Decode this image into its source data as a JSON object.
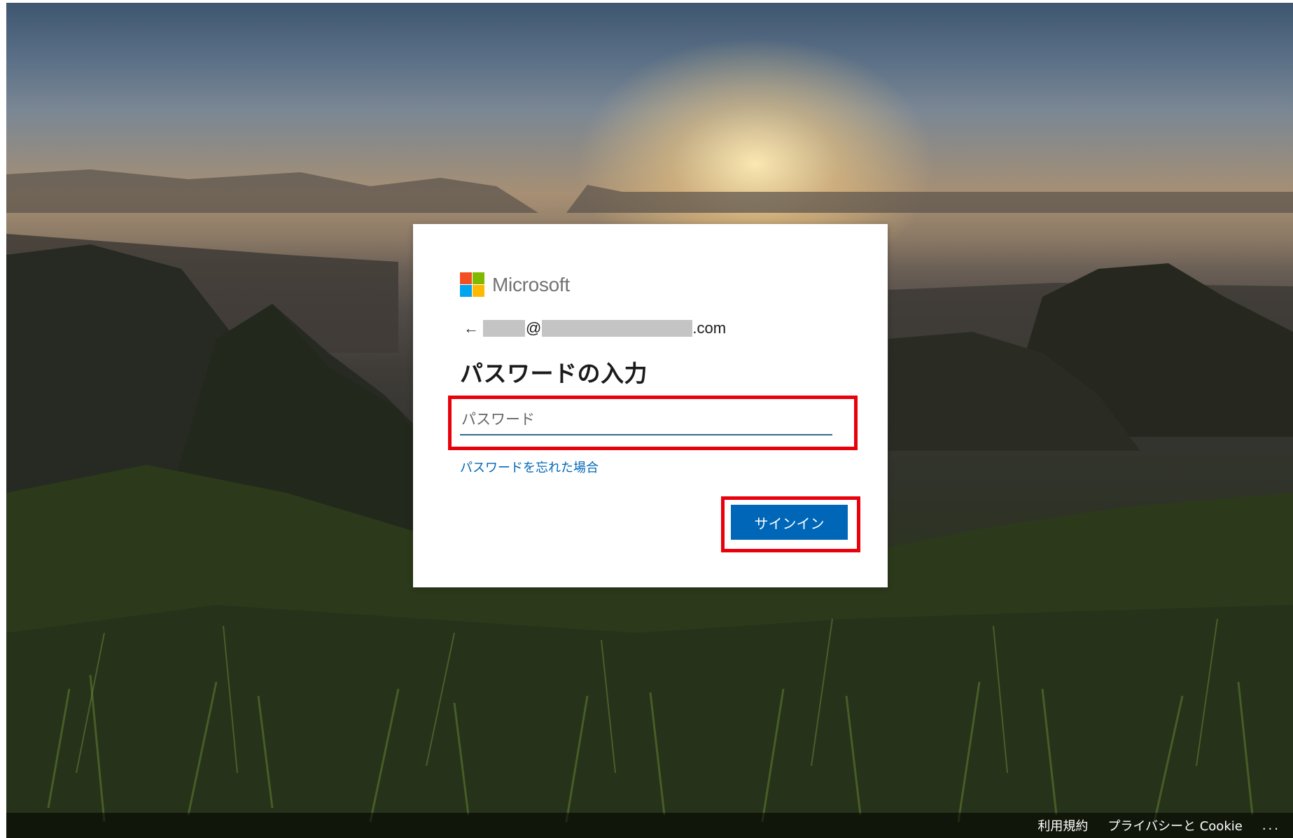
{
  "brand": {
    "name": "Microsoft",
    "colors": {
      "red": "#f25022",
      "green": "#7fba00",
      "blue": "#00a4ef",
      "yellow": "#ffb900"
    }
  },
  "identity": {
    "back_icon": "←",
    "at_sign": "@",
    "domain_suffix": ".com"
  },
  "signin_card": {
    "title": "パスワードの入力",
    "password_placeholder": "パスワード",
    "password_value": "",
    "forgot_link": "パスワードを忘れた場合",
    "signin_button": "サインイン"
  },
  "footer": {
    "terms": "利用規約",
    "privacy": "プライバシーと Cookie",
    "more": "..."
  },
  "theme": {
    "accent": "#0067b8",
    "highlight": "#e8000b"
  }
}
